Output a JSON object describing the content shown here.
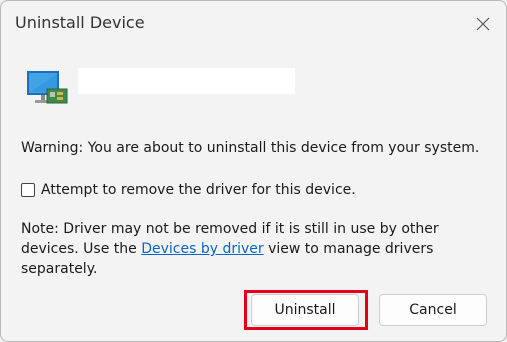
{
  "dialog": {
    "title": "Uninstall Device",
    "device_name": "",
    "warning": "Warning: You are about to uninstall this device from your system.",
    "checkbox_label": "Attempt to remove the driver for this device.",
    "checkbox_checked": false,
    "note_before": "Note: Driver may not be removed if it is still in use by other devices. Use the ",
    "note_link": "Devices by driver",
    "note_after": " view to manage drivers separately.",
    "uninstall_label": "Uninstall",
    "cancel_label": "Cancel",
    "close_icon": "close-icon",
    "device_icon": "monitor-device-icon",
    "highlight_color": "#e3001b",
    "link_color": "#0a66c2"
  }
}
